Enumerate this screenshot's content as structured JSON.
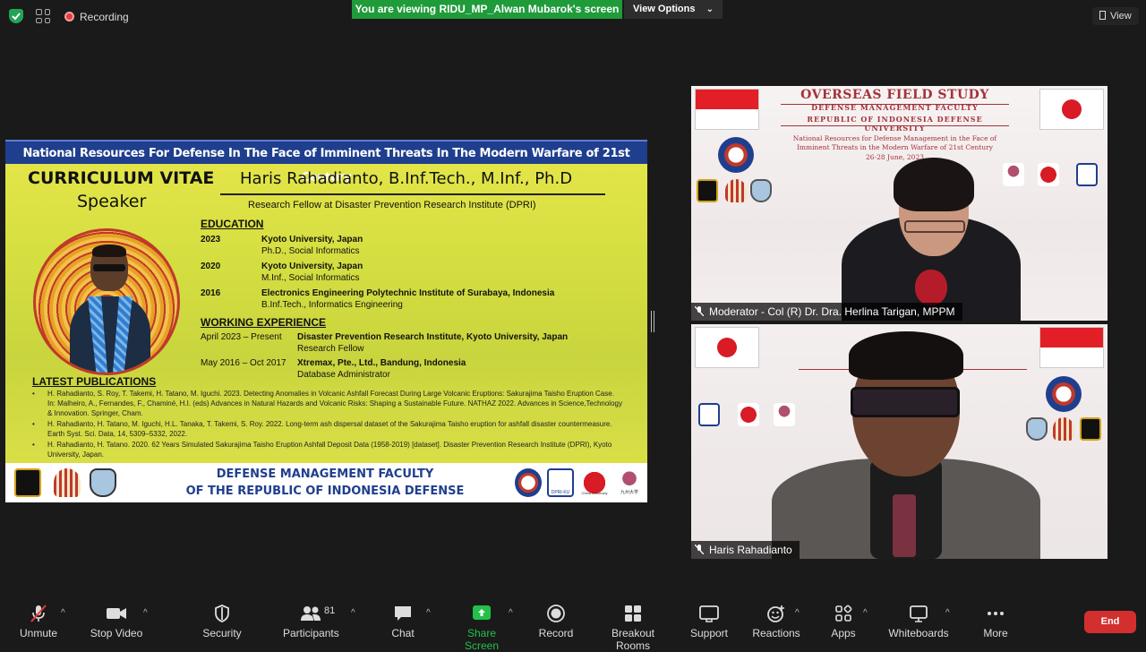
{
  "topbar": {
    "recording_label": "Recording",
    "viewing_banner": "You are viewing RIDU_MP_Alwan Mubarok's screen",
    "view_options_label": "View Options",
    "view_label": "View"
  },
  "shared_screen": {
    "banner": "National Resources For Defense In The Face of Imminent Threats In The Modern Warfare of 21st Century",
    "cv_title": "CURRICULUM VITAE",
    "cv_subtitle": "Speaker",
    "speaker_name": "Haris Rahadianto, B.Inf.Tech., M.Inf., Ph.D",
    "speaker_role": "Research Fellow at Disaster Prevention Research Institute (DPRI)",
    "education_heading": "EDUCATION",
    "education": [
      {
        "year": "2023",
        "school": "Kyoto University, Japan",
        "degree": "Ph.D., Social Informatics"
      },
      {
        "year": "2020",
        "school": "Kyoto University, Japan",
        "degree": "M.Inf., Social Informatics"
      },
      {
        "year": "2016",
        "school": "Electronics Engineering Polytechnic Institute of Surabaya, Indonesia",
        "degree": "B.Inf.Tech., Informatics Engineering"
      }
    ],
    "experience_heading": "WORKING EXPERIENCE",
    "experience": [
      {
        "period": "April 2023 – Present",
        "org": "Disaster Prevention Research Institute, Kyoto University, Japan",
        "title": "Research Fellow"
      },
      {
        "period": "May 2016 – Oct 2017",
        "org": "Xtremax, Pte., Ltd., Bandung, Indonesia",
        "title": "Database Administrator"
      }
    ],
    "publications_heading": "LATEST PUBLICATIONS",
    "publications": [
      "H. Rahadianto, S. Roy, T. Takemi, H. Tatano, M. Iguchi. 2023. Detecting Anomalies in Volcanic Ashfall Forecast During Large Volcanic Eruptions: Sakurajima Taisho Eruption Case. In: Malheiro, A., Fernandes, F., Chaminé, H.I. (eds) Advances in Natural Hazards and Volcanic Risks: Shaping a Sustainable Future. NATHAZ 2022. Advances in Science,Technology & Innovation. Springer, Cham.",
      "H. Rahadianto, H. Tatano, M. Iguchi, H.L. Tanaka, T. Takemi, S. Roy. 2022. Long-term ash dispersal dataset of the Sakurajima Taisho eruption for ashfall disaster countermeasure. Earth Syst. Sci. Data, 14, 5309–5332, 2022.",
      "H. Rahadianto, H. Tatano. 2020. 62 Years Simulated Sakurajima Taisho Eruption Ashfall Deposit Data (1958-2019) [dataset]. Disaster Prevention Research Institute (DPRI), Kyoto University, Japan."
    ],
    "footer_line1": "DEFENSE MANAGEMENT FACULTY",
    "footer_line2": "OF THE REPUBLIC OF INDONESIA DEFENSE UNIVERSITY",
    "footer_logo_text_1": "DPRI-KU",
    "footer_logo_text_2": "Chiba University",
    "footer_logo_text_3": "九州大学"
  },
  "tiles": [
    {
      "backdrop_title": "OVERSEAS FIELD STUDY",
      "backdrop_line1": "DEFENSE MANAGEMENT FACULTY",
      "backdrop_line2": "REPUBLIC OF INDONESIA DEFENSE UNIVERSITY",
      "backdrop_line3": "National Resources for Defense Management in the Face of Imminent Threats in the Modern Warfare of 21st Century",
      "backdrop_date": "26-28 June, 2023",
      "name": "Moderator - Col (R) Dr. Dra. Herlina Tarigan, MPPM"
    },
    {
      "name": "Haris Rahadianto"
    }
  ],
  "toolbar": {
    "items": [
      {
        "label": "Unmute",
        "icon": "mic-off-icon"
      },
      {
        "label": "Stop Video",
        "icon": "video-camera-icon"
      },
      {
        "label": "Security",
        "icon": "shield-icon"
      },
      {
        "label": "Participants",
        "icon": "participants-icon"
      },
      {
        "label": "Chat",
        "icon": "chat-icon"
      },
      {
        "label": "Share Screen",
        "icon": "share-screen-icon"
      },
      {
        "label": "Record",
        "icon": "record-icon"
      },
      {
        "label": "Breakout Rooms",
        "icon": "breakout-rooms-icon"
      },
      {
        "label": "Support",
        "icon": "support-icon"
      },
      {
        "label": "Reactions",
        "icon": "reactions-icon"
      },
      {
        "label": "Apps",
        "icon": "apps-icon"
      },
      {
        "label": "Whiteboards",
        "icon": "whiteboard-icon"
      },
      {
        "label": "More",
        "icon": "more-icon"
      }
    ],
    "participants_count": "81",
    "end_label": "End"
  },
  "colors": {
    "banner_green": "#1f9b3a",
    "share_green": "#23c04a",
    "end_red": "#d32f2f",
    "slide_blue": "#1f3f8e",
    "slide_yellow": "#dfe24a"
  }
}
